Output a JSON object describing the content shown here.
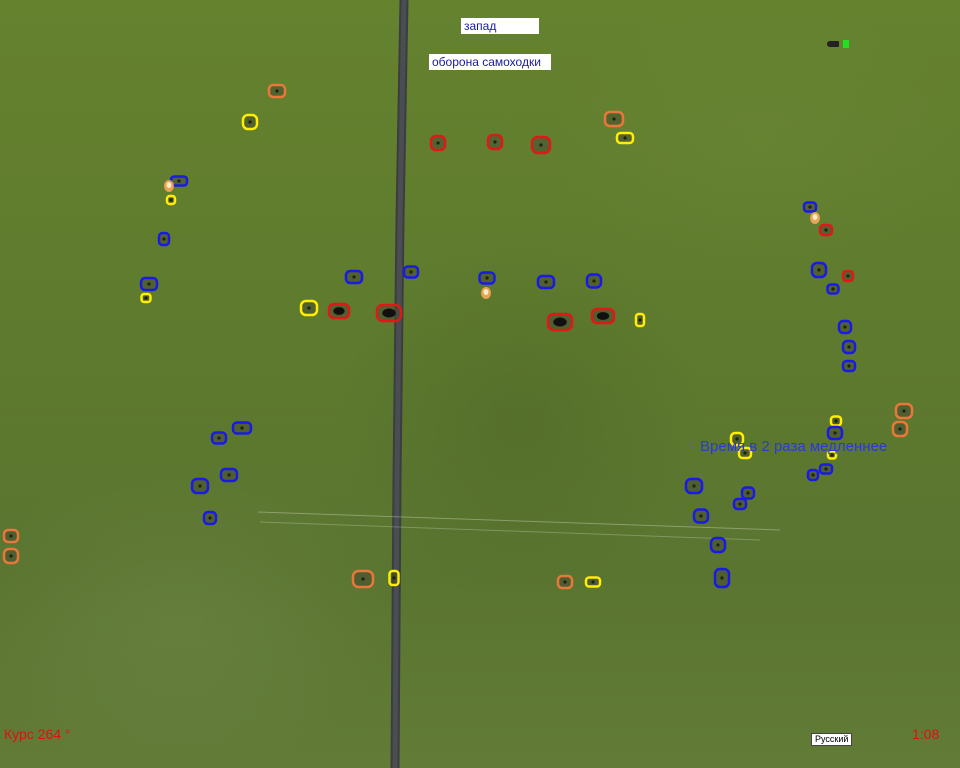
{
  "hud": {
    "direction_label": "запад",
    "mission_label": "оборона самоходки",
    "time_hint": "Время в 2 раза медленнее",
    "heading": "Курс 264 °",
    "clock": "1:08",
    "language": "Русский"
  },
  "colors": {
    "ground": "#5f7a32",
    "road": "#4a4e52",
    "hud_text": "#1a1aa0",
    "alert_text": "#e01010",
    "hint_text": "#2a3ad8",
    "status_ok": "#22e022"
  },
  "marker_colors": {
    "red": "#e01818",
    "blue": "#1a1ae6",
    "yellow": "#ffee00",
    "orange": "#e8783a"
  },
  "icons": [
    "compass-needle-icon",
    "status-indicator-icon",
    "unit-marker-icon",
    "muzzle-flash-icon",
    "road-icon"
  ]
}
